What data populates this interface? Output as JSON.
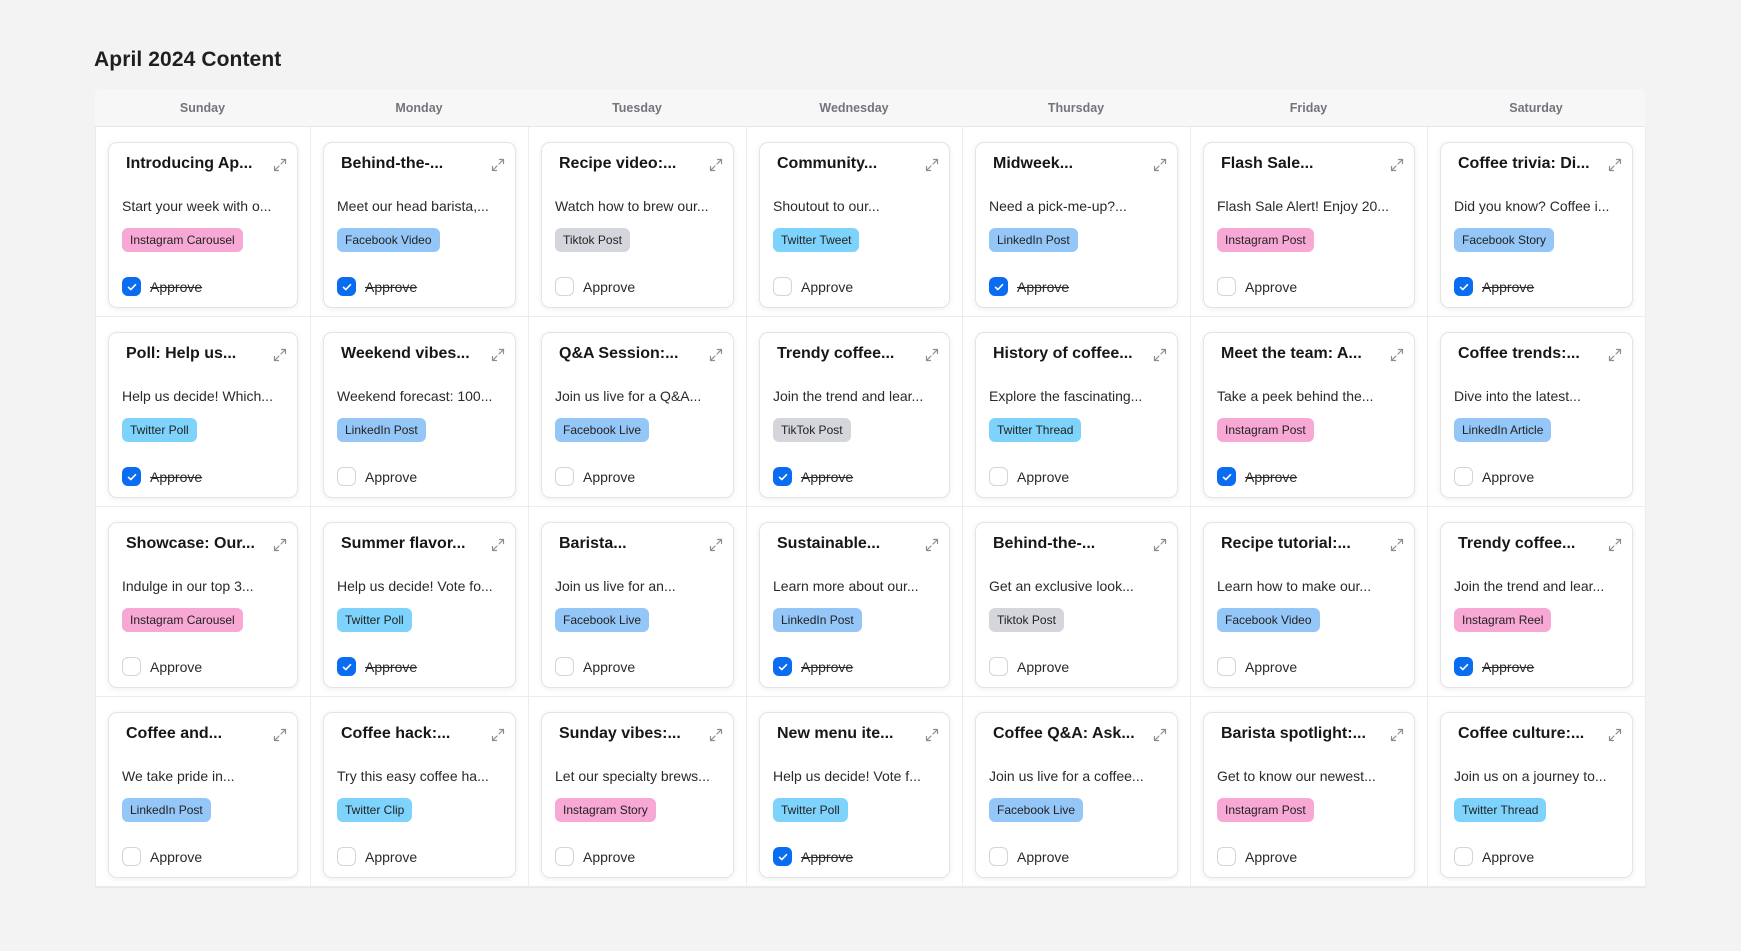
{
  "page": {
    "title": "April 2024 Content"
  },
  "colors": {
    "instagram": "#f7a8d4",
    "facebook": "#94c6f8",
    "twitter": "#7dd3fb",
    "linkedin": "#94c6f8",
    "tiktok": "#d4d6dc",
    "checkbox_checked": "#0a6cf0"
  },
  "days": [
    "Sunday",
    "Monday",
    "Tuesday",
    "Wednesday",
    "Thursday",
    "Friday",
    "Saturday"
  ],
  "approve_label": "Approve",
  "weeks": [
    [
      {
        "title": "Introducing Ap...",
        "description": "Start your week with o...",
        "tag": "Instagram Carousel",
        "platform": "instagram",
        "approved": true
      },
      {
        "title": "Behind-the-...",
        "description": "Meet our head barista,...",
        "tag": "Facebook Video",
        "platform": "facebook",
        "approved": true
      },
      {
        "title": "Recipe video:...",
        "description": "Watch how to brew our...",
        "tag": "Tiktok Post",
        "platform": "tiktok",
        "approved": false
      },
      {
        "title": "Community...",
        "description": "Shoutout to our...",
        "tag": "Twitter Tweet",
        "platform": "twitter",
        "approved": false
      },
      {
        "title": "Midweek...",
        "description": "Need a pick-me-up?...",
        "tag": "LinkedIn Post",
        "platform": "linkedin",
        "approved": true
      },
      {
        "title": "Flash Sale...",
        "description": "Flash Sale Alert! Enjoy 20...",
        "tag": "Instagram Post",
        "platform": "instagram",
        "approved": false
      },
      {
        "title": "Coffee trivia: Di...",
        "description": "Did you know? Coffee i...",
        "tag": "Facebook Story",
        "platform": "facebook",
        "approved": true
      }
    ],
    [
      {
        "title": "Poll: Help us...",
        "description": "Help us decide! Which...",
        "tag": "Twitter Poll",
        "platform": "twitter",
        "approved": true
      },
      {
        "title": "Weekend vibes...",
        "description": "Weekend forecast: 100...",
        "tag": "LinkedIn Post",
        "platform": "linkedin",
        "approved": false
      },
      {
        "title": "Q&A Session:...",
        "description": "Join us live for a Q&A...",
        "tag": "Facebook Live",
        "platform": "facebook",
        "approved": false
      },
      {
        "title": "Trendy coffee...",
        "description": "Join the trend and lear...",
        "tag": "TikTok Post",
        "platform": "tiktok",
        "approved": true
      },
      {
        "title": "History of coffee...",
        "description": "Explore the fascinating...",
        "tag": "Twitter Thread",
        "platform": "twitter",
        "approved": false
      },
      {
        "title": "Meet the team: A...",
        "description": "Take a peek behind the...",
        "tag": "Instagram Post",
        "platform": "instagram",
        "approved": true
      },
      {
        "title": "Coffee trends:...",
        "description": "Dive into the latest...",
        "tag": "LinkedIn Article",
        "platform": "linkedin",
        "approved": false
      }
    ],
    [
      {
        "title": "Showcase: Our...",
        "description": "Indulge in our top 3...",
        "tag": "Instagram Carousel",
        "platform": "instagram",
        "approved": false
      },
      {
        "title": "Summer flavor...",
        "description": "Help us decide! Vote fo...",
        "tag": "Twitter Poll",
        "platform": "twitter",
        "approved": true
      },
      {
        "title": "Barista...",
        "description": "Join us live for an...",
        "tag": "Facebook Live",
        "platform": "facebook",
        "approved": false
      },
      {
        "title": "Sustainable...",
        "description": "Learn more about our...",
        "tag": "LinkedIn Post",
        "platform": "linkedin",
        "approved": true
      },
      {
        "title": "Behind-the-...",
        "description": "Get an exclusive look...",
        "tag": "Tiktok Post",
        "platform": "tiktok",
        "approved": false
      },
      {
        "title": "Recipe tutorial:...",
        "description": "Learn how to make our...",
        "tag": "Facebook Video",
        "platform": "facebook",
        "approved": false
      },
      {
        "title": "Trendy coffee...",
        "description": "Join the trend and lear...",
        "tag": "Instagram Reel",
        "platform": "instagram",
        "approved": true
      }
    ],
    [
      {
        "title": "Coffee and...",
        "description": "We take pride in...",
        "tag": "LinkedIn Post",
        "platform": "linkedin",
        "approved": false
      },
      {
        "title": "Coffee hack:...",
        "description": "Try this easy coffee ha...",
        "tag": "Twitter Clip",
        "platform": "twitter",
        "approved": false
      },
      {
        "title": "Sunday vibes:...",
        "description": "Let our specialty brews...",
        "tag": "Instagram Story",
        "platform": "instagram",
        "approved": false
      },
      {
        "title": "New menu ite...",
        "description": "Help us decide! Vote f...",
        "tag": "Twitter Poll",
        "platform": "twitter",
        "approved": true
      },
      {
        "title": "Coffee Q&A: Ask...",
        "description": "Join us live for a coffee...",
        "tag": "Facebook Live",
        "platform": "facebook",
        "approved": false
      },
      {
        "title": "Barista spotlight:...",
        "description": "Get to know our newest...",
        "tag": "Instagram Post",
        "platform": "instagram",
        "approved": false
      },
      {
        "title": "Coffee culture:...",
        "description": "Join us on a journey to...",
        "tag": "Twitter Thread",
        "platform": "twitter",
        "approved": false
      }
    ]
  ]
}
